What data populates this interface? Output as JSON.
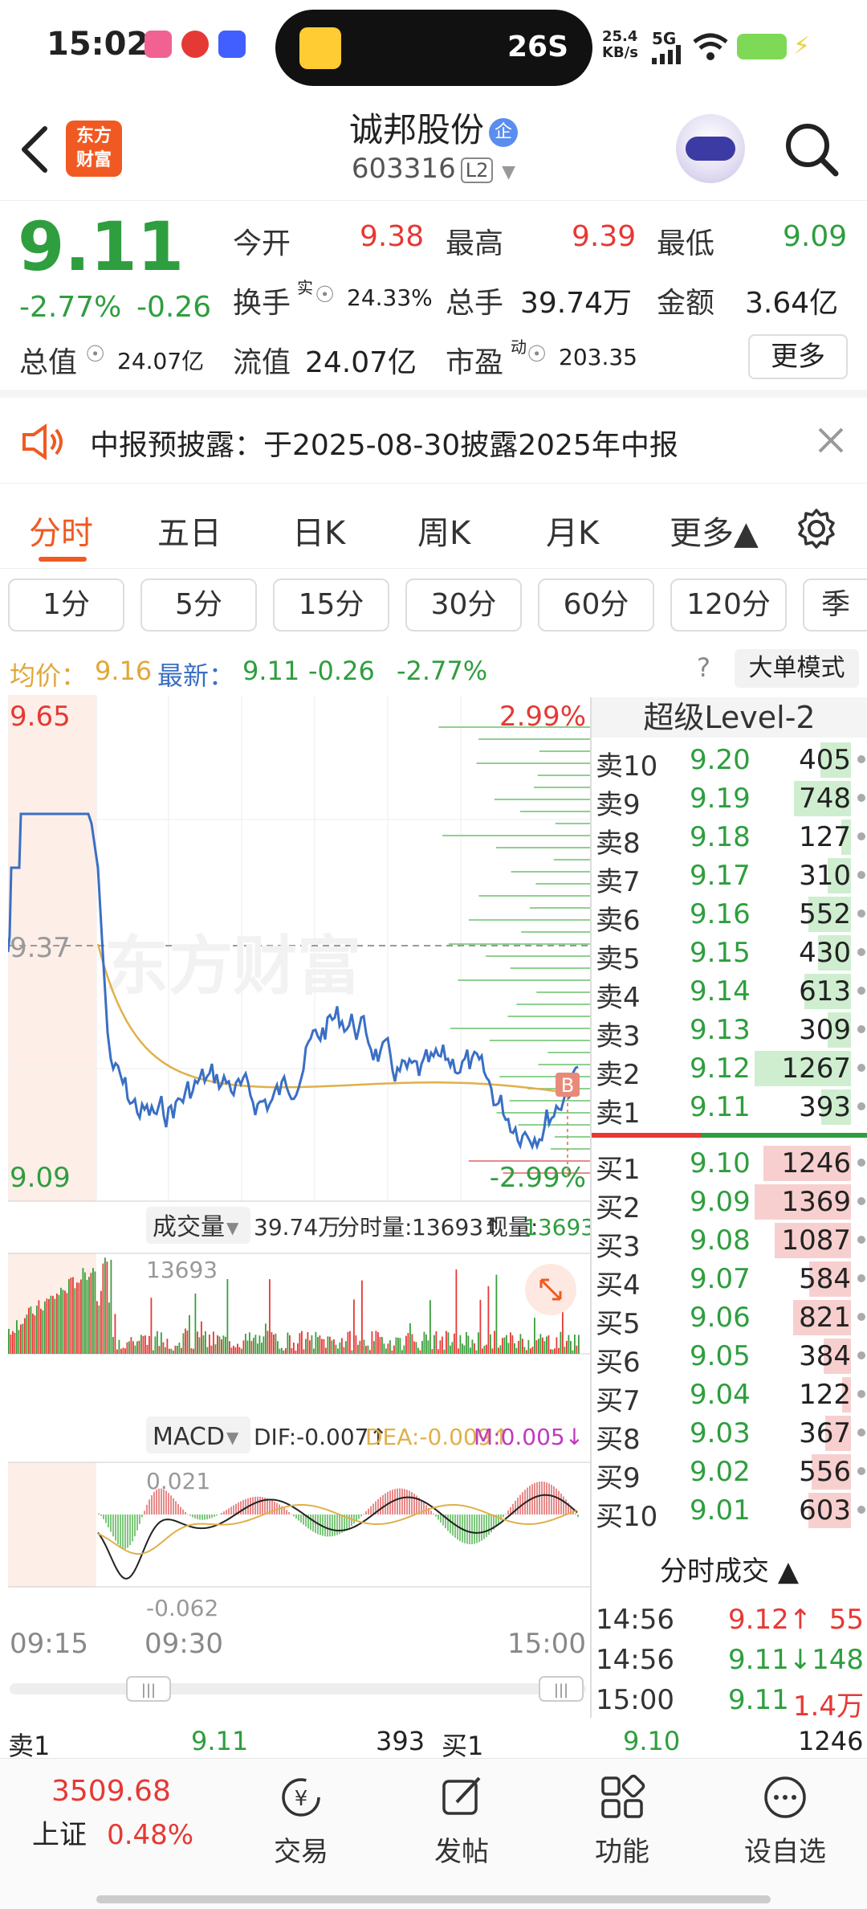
{
  "status_bar": {
    "time": "15:02",
    "speed": "26S",
    "net_rate": "25.4",
    "net_unit": "KB/s",
    "net_type": "5G"
  },
  "header": {
    "stock_name": "诚邦股份",
    "badge": "企",
    "stock_code": "603316",
    "level_badge": "L2",
    "logo_line1": "东方",
    "logo_line2": "财富"
  },
  "quote": {
    "price": "9.11",
    "change_pct": "-2.77%",
    "change": "-0.26",
    "open_label": "今开",
    "open": "9.38",
    "high_label": "最高",
    "high": "9.39",
    "low_label": "最低",
    "low": "9.09",
    "turnover_label": "换手",
    "turnover_sup": "实",
    "turnover": "24.33%",
    "volume_label": "总手",
    "volume": "39.74万",
    "amount_label": "金额",
    "amount": "3.64亿",
    "mktcap_label": "总值",
    "mktcap": "24.07亿",
    "float_label": "流值",
    "float": "24.07亿",
    "pe_label": "市盈",
    "pe_sup": "动",
    "pe": "203.35",
    "more_button": "更多"
  },
  "notice": {
    "text": "中报预披露：于2025-08-30披露2025年中报"
  },
  "period_tabs": [
    "分时",
    "五日",
    "日K",
    "周K",
    "月K",
    "更多▲"
  ],
  "minute_tabs": [
    "1分",
    "5分",
    "15分",
    "30分",
    "60分",
    "120分",
    "季"
  ],
  "info_line": {
    "avg_label": "均价：",
    "avg": "9.16",
    "latest_label": "最新：",
    "latest": "9.11",
    "change": "-0.26",
    "change_pct": "-2.77%",
    "big_order_button": "大单模式"
  },
  "chart_labels": {
    "price_high": "9.65",
    "price_mid": "9.37",
    "price_low": "9.09",
    "pct_high": "2.99%",
    "pct_low": "-2.99%",
    "watermark": "东方财富",
    "vol_selector": "成交量",
    "vol_total": "39.74万",
    "vol_minute_label": "分时量:",
    "vol_minute": "13693↑",
    "vol_now_label": "现量:",
    "vol_now": "13693",
    "vol_axis": "13693",
    "macd_selector": "MACD",
    "dif": "DIF:-0.007↑",
    "dea": "DEA:-0.009↑",
    "m": "M:0.005↓",
    "macd_top": "0.021",
    "macd_bottom": "-0.062",
    "time_start": "09:15",
    "time_open": "09:30",
    "time_end": "15:00",
    "b_marker": "B"
  },
  "order_book": {
    "title": "超级Level-2",
    "asks": [
      {
        "side": "卖10",
        "price": "9.20",
        "vol": "405",
        "frac": 0.32
      },
      {
        "side": "卖9",
        "price": "9.19",
        "vol": "748",
        "frac": 0.59
      },
      {
        "side": "卖8",
        "price": "9.18",
        "vol": "127",
        "frac": 0.1
      },
      {
        "side": "卖7",
        "price": "9.17",
        "vol": "310",
        "frac": 0.24
      },
      {
        "side": "卖6",
        "price": "9.16",
        "vol": "552",
        "frac": 0.44
      },
      {
        "side": "卖5",
        "price": "9.15",
        "vol": "430",
        "frac": 0.34
      },
      {
        "side": "卖4",
        "price": "9.14",
        "vol": "613",
        "frac": 0.48
      },
      {
        "side": "卖3",
        "price": "9.13",
        "vol": "309",
        "frac": 0.24
      },
      {
        "side": "卖2",
        "price": "9.12",
        "vol": "1267",
        "frac": 1.0
      },
      {
        "side": "卖1",
        "price": "9.11",
        "vol": "393",
        "frac": 0.31
      }
    ],
    "bids": [
      {
        "side": "买1",
        "price": "9.10",
        "vol": "1246",
        "frac": 0.91
      },
      {
        "side": "买2",
        "price": "9.09",
        "vol": "1369",
        "frac": 1.0
      },
      {
        "side": "买3",
        "price": "9.08",
        "vol": "1087",
        "frac": 0.79
      },
      {
        "side": "买4",
        "price": "9.07",
        "vol": "584",
        "frac": 0.43
      },
      {
        "side": "买5",
        "price": "9.06",
        "vol": "821",
        "frac": 0.6
      },
      {
        "side": "买6",
        "price": "9.05",
        "vol": "384",
        "frac": 0.28
      },
      {
        "side": "买7",
        "price": "9.04",
        "vol": "122",
        "frac": 0.09
      },
      {
        "side": "买8",
        "price": "9.03",
        "vol": "367",
        "frac": 0.27
      },
      {
        "side": "买9",
        "price": "9.02",
        "vol": "556",
        "frac": 0.41
      },
      {
        "side": "买10",
        "price": "9.01",
        "vol": "603",
        "frac": 0.44
      }
    ],
    "trades_title": "分时成交 ▲",
    "trades": [
      {
        "time": "14:56",
        "price": "9.12↑",
        "vol": "55"
      },
      {
        "time": "14:56",
        "price": "9.11↓",
        "vol": "148"
      },
      {
        "time": "15:00",
        "price": "9.11",
        "vol": "1.4万"
      }
    ]
  },
  "bottom_strip": {
    "ask_label": "卖1",
    "ask_price": "9.11",
    "ask_vol": "393",
    "bid_label": "买1",
    "bid_price": "9.10",
    "bid_vol": "1246"
  },
  "bottom_nav": {
    "index_value": "3509.68",
    "index_name": "上证",
    "index_change": "0.48%",
    "items": [
      "交易",
      "发帖",
      "功能",
      "设自选"
    ]
  },
  "colors": {
    "up": "#e53935",
    "down": "#2e9e3e",
    "accent": "#f05a22",
    "price_line": "#3a6fc4",
    "avg_line": "#e0b04a"
  }
}
